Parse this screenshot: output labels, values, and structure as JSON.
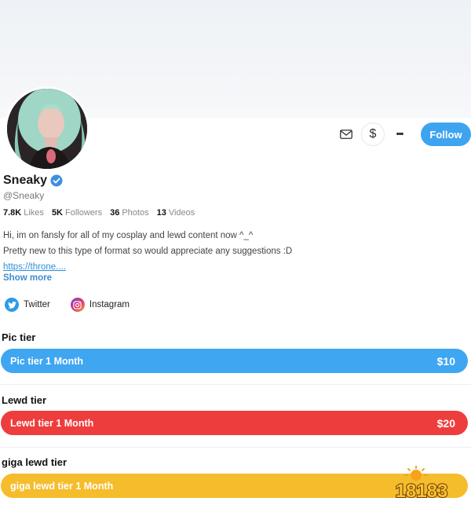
{
  "profile": {
    "display_name": "Sneaky",
    "handle": "@Sneaky",
    "verified": true,
    "avatar_icon": "avatar-photo"
  },
  "actions": {
    "message_icon": "envelope-icon",
    "tip_icon": "dollar-icon",
    "tip_label": "$",
    "more_icon": "more-dots-icon",
    "more_label": "•••",
    "follow_label": "Follow"
  },
  "stats": [
    {
      "value": "7.8K",
      "label": "Likes"
    },
    {
      "value": "5K",
      "label": "Followers"
    },
    {
      "value": "36",
      "label": "Photos"
    },
    {
      "value": "13",
      "label": "Videos"
    }
  ],
  "bio": {
    "line1": "Hi, im on fansly for all of my cosplay and lewd content now ^_^",
    "line2": "Pretty new to this type of format so would appreciate any suggestions :D",
    "link": "https://throne....",
    "show_more": "Show more"
  },
  "socials": [
    {
      "name": "Twitter",
      "icon": "twitter-icon"
    },
    {
      "name": "Instagram",
      "icon": "instagram-icon"
    }
  ],
  "tiers": [
    {
      "title": "Pic tier",
      "button": "Pic tier 1 Month",
      "price": "$10",
      "color": "#3fa6f2"
    },
    {
      "title": "Lewd tier",
      "button": "Lewd tier 1 Month",
      "price": "$20",
      "color": "#ee3d3d"
    },
    {
      "title": "giga lewd tier",
      "button": "giga lewd tier 1 Month",
      "price": "",
      "color": "#f5bc2c"
    }
  ],
  "colors": {
    "accent": "#3ea4f0",
    "link": "#2b8fd8"
  },
  "watermark": "18183"
}
